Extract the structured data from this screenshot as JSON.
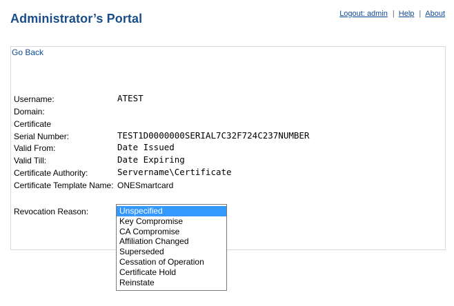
{
  "header": {
    "title": "Administrator’s Portal",
    "links": {
      "logout": "Logout: admin",
      "separator": "|",
      "help": "Help",
      "about": "About"
    }
  },
  "panel": {
    "go_back": "Go Back",
    "fields": [
      {
        "label": "Username:",
        "value": "ATEST"
      },
      {
        "label": "Domain:",
        "value": ""
      },
      {
        "label": "Certificate",
        "value": ""
      },
      {
        "label": "Serial Number:",
        "value": "TEST1D0000000SERIAL7C32F724C237NUMBER"
      },
      {
        "label": "Valid From:",
        "value": "Date Issued"
      },
      {
        "label": "Valid Till:",
        "value": "Date Expiring"
      },
      {
        "label": "Certificate Authority:",
        "value": "Servername\\Certificate"
      },
      {
        "label": "Certificate Template Name:",
        "value": "ONESmartcard"
      }
    ],
    "revocation": {
      "label": "Revocation Reason:",
      "selected": "Unspecified",
      "options": [
        "Unspecified",
        "Key Compromise",
        "CA Compromise",
        "Affiliation Changed",
        "Superseded",
        "Cessation of Operation",
        "Certificate Hold",
        "Reinstate"
      ]
    }
  },
  "colors": {
    "title": "#1a4e8a",
    "link": "#0b4a9a",
    "selection": "#3399ff",
    "panel_border": "#d9d9d9"
  }
}
